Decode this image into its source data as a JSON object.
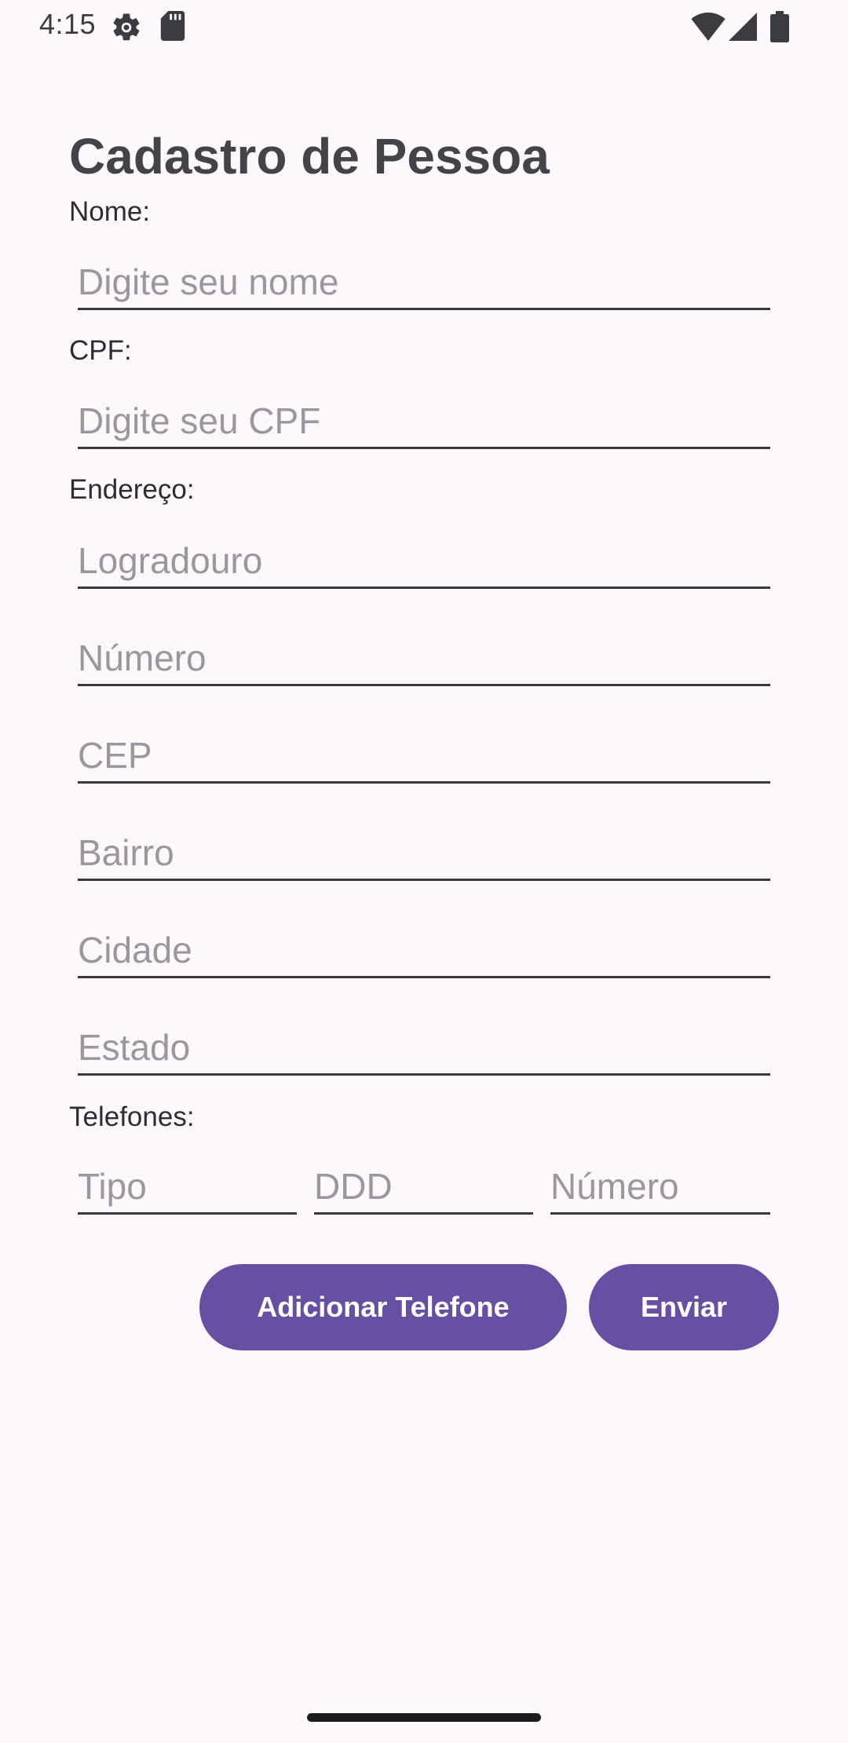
{
  "status_bar": {
    "time": "4:15",
    "icons": [
      "settings-icon",
      "sd-card-icon",
      "wifi-icon",
      "signal-icon",
      "battery-icon"
    ]
  },
  "form": {
    "title": "Cadastro de Pessoa",
    "nome": {
      "label": "Nome:",
      "placeholder": "Digite seu nome",
      "value": ""
    },
    "cpf": {
      "label": "CPF:",
      "placeholder": "Digite seu CPF",
      "value": ""
    },
    "endereco": {
      "label": "Endereço:",
      "logradouro_placeholder": "Logradouro",
      "numero_placeholder": "Número",
      "cep_placeholder": "CEP",
      "bairro_placeholder": "Bairro",
      "cidade_placeholder": "Cidade",
      "estado_placeholder": "Estado"
    },
    "telefones": {
      "label": "Telefones:",
      "tipo_placeholder": "Tipo",
      "ddd_placeholder": "DDD",
      "numero_placeholder": "Número"
    },
    "buttons": {
      "add_phone_label": "Adicionar Telefone",
      "submit_label": "Enviar"
    }
  },
  "colors": {
    "background": "#fef7fb",
    "primary": "#6750a4",
    "title": "#45434a",
    "placeholder": "#9a979f"
  }
}
